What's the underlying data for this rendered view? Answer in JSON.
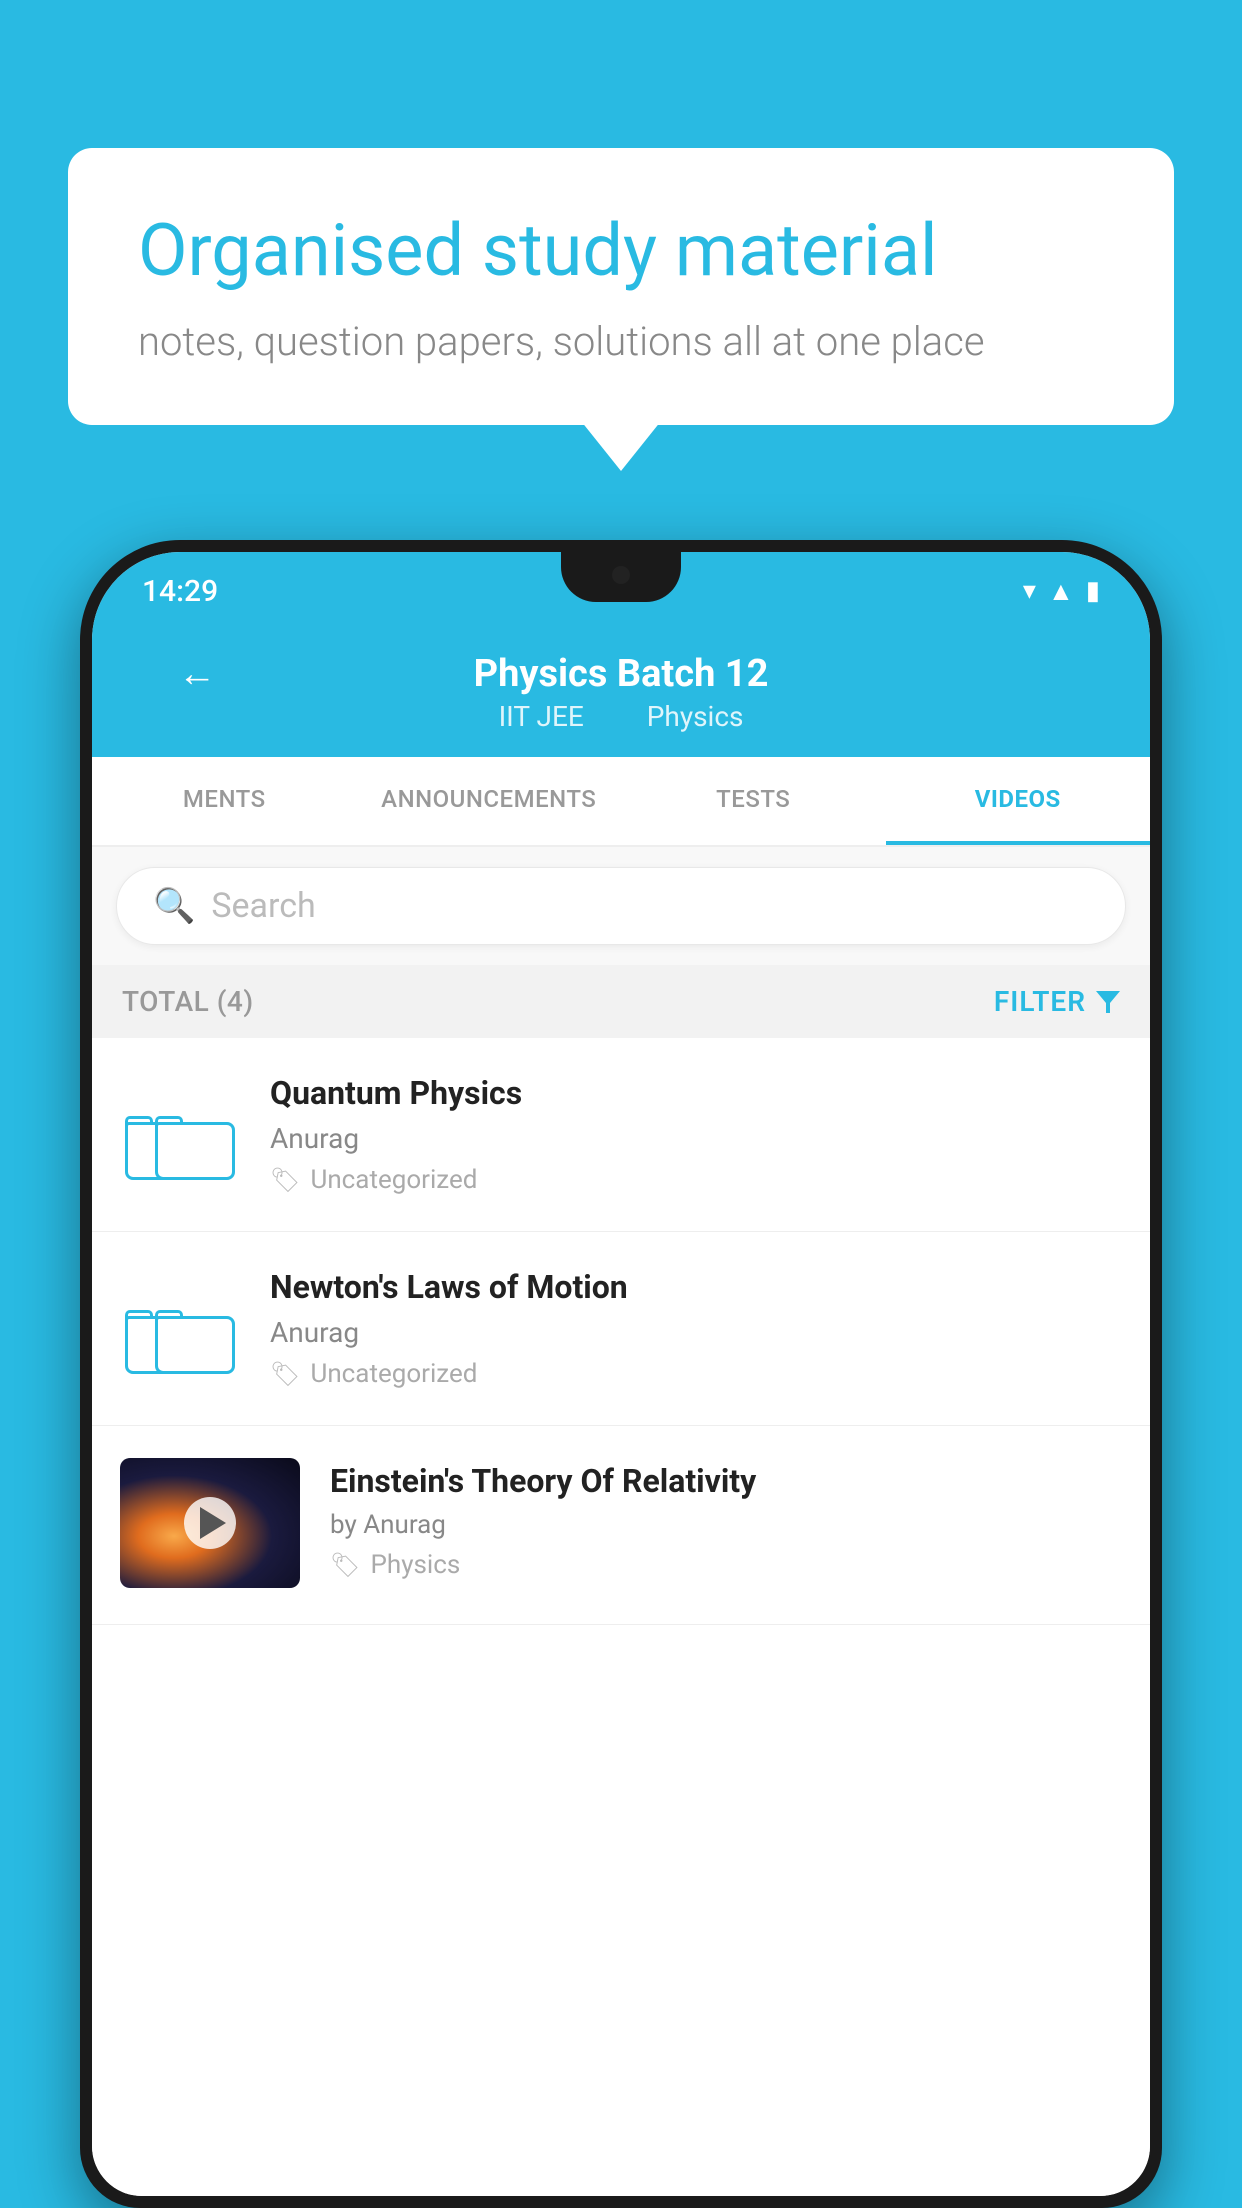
{
  "background": {
    "color": "#29BAE2"
  },
  "speech_bubble": {
    "headline": "Organised study material",
    "subtext": "notes, question papers, solutions all at one place"
  },
  "phone": {
    "status_bar": {
      "time": "14:29"
    },
    "header": {
      "back_label": "←",
      "title": "Physics Batch 12",
      "subtitle_part1": "IIT JEE",
      "subtitle_part2": "Physics"
    },
    "tabs": [
      {
        "label": "MENTS",
        "active": false
      },
      {
        "label": "ANNOUNCEMENTS",
        "active": false
      },
      {
        "label": "TESTS",
        "active": false
      },
      {
        "label": "VIDEOS",
        "active": true
      }
    ],
    "search": {
      "placeholder": "Search"
    },
    "filter_bar": {
      "total_label": "TOTAL (4)",
      "filter_label": "FILTER"
    },
    "videos": [
      {
        "title": "Quantum Physics",
        "author": "Anurag",
        "tag": "Uncategorized",
        "type": "folder"
      },
      {
        "title": "Newton's Laws of Motion",
        "author": "Anurag",
        "tag": "Uncategorized",
        "type": "folder"
      },
      {
        "title": "Einstein's Theory Of Relativity",
        "author": "by Anurag",
        "tag": "Physics",
        "type": "video"
      }
    ]
  }
}
